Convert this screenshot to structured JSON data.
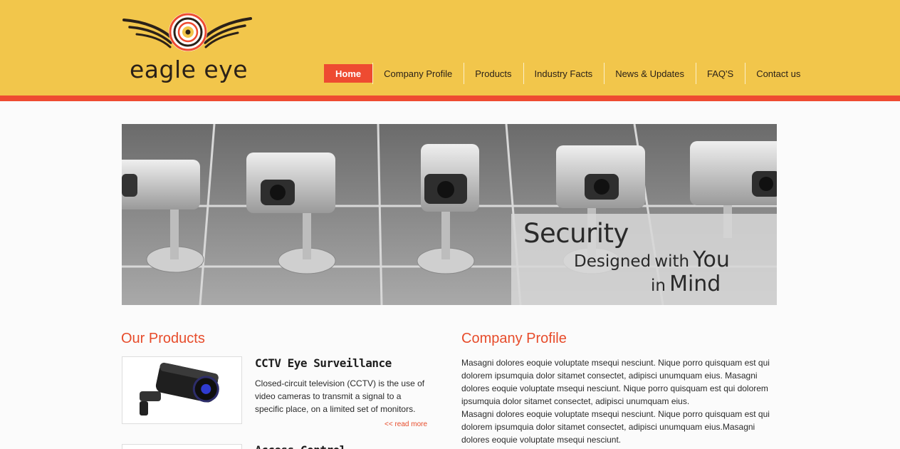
{
  "brand": {
    "name": "eagle eye",
    "logo_icon": "eagle-eye-emblem"
  },
  "nav": {
    "items": [
      {
        "label": "Home",
        "active": true
      },
      {
        "label": "Company Profile",
        "active": false
      },
      {
        "label": "Products",
        "active": false
      },
      {
        "label": "Industry Facts",
        "active": false
      },
      {
        "label": "News & Updates",
        "active": false
      },
      {
        "label": "FAQ'S",
        "active": false
      },
      {
        "label": "Contact us",
        "active": false
      }
    ]
  },
  "banner": {
    "line1": "Security",
    "line2_small": "Designed",
    "line2_small_b": "with",
    "line2_big": "You",
    "line3_small": "in",
    "line3_big": "Mind"
  },
  "products": {
    "title": "Our Products",
    "items": [
      {
        "name": "CCTV Eye Surveillance",
        "description": "Closed-circuit television (CCTV) is the use of video cameras to transmit a signal to a specific place, on a limited set of monitors.",
        "read_more": "<< read more"
      },
      {
        "name": "Access Control"
      }
    ]
  },
  "profile": {
    "title": "Company Profile",
    "text": "Masagni dolores eoquie voluptate msequi nesciunt. Nique porro quisquam est qui dolorem ipsumquia dolor sitamet consectet, adipisci unumquam eius. Masagni dolores eoquie voluptate msequi nesciunt. Nique porro quisquam est qui dolorem ipsumquia dolor sitamet consectet, adipisci unumquam eius.\nMasagni dolores eoquie voluptate msequi nesciunt. Nique porro quisquam est qui dolorem ipsumquia dolor sitamet consectet, adipisci unumquam eius.Masagni dolores eoquie voluptate msequi nesciunt."
  },
  "colors": {
    "header": "#f2c64b",
    "accent": "#ee4b31",
    "title": "#e74c2b"
  }
}
